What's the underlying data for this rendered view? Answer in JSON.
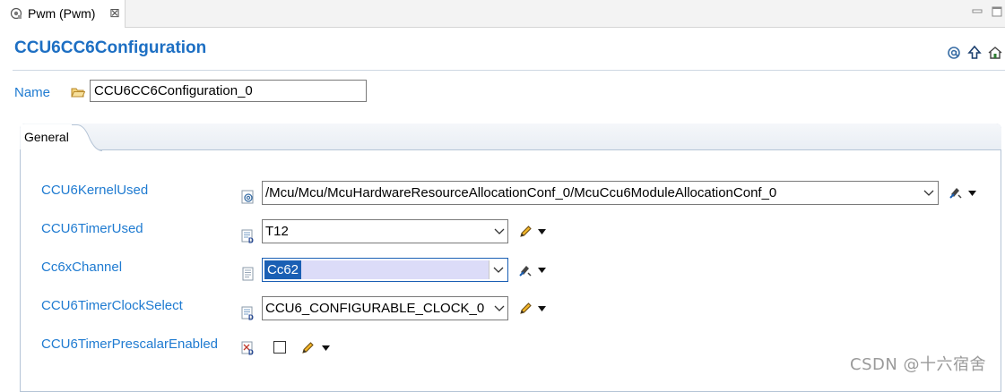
{
  "editor_tab": {
    "label": "Pwm (Pwm)",
    "close": "⊠"
  },
  "header": {
    "title": "CCU6CC6Configuration",
    "icons": [
      "at-sign-icon",
      "arrow-up-icon",
      "home-icon"
    ]
  },
  "name_field": {
    "label": "Name",
    "value": "CCU6CC6Configuration_0"
  },
  "section": {
    "tab_label": "General"
  },
  "params": [
    {
      "label": "CCU6KernelUsed",
      "value": "/Mcu/Mcu/McuHardwareResourceAllocationConf_0/McuCcu6ModuleAllocationConf_0",
      "icon": "reference-icon",
      "action": "link-icon"
    },
    {
      "label": "CCU6TimerUsed",
      "value": "T12",
      "icon": "derived-param-icon",
      "action": "pencil-icon"
    },
    {
      "label": "Cc6xChannel",
      "value": "Cc62",
      "icon": "param-doc-icon",
      "action": "link-icon",
      "selected": true
    },
    {
      "label": "CCU6TimerClockSelect",
      "value": "CCU6_CONFIGURABLE_CLOCK_0",
      "icon": "derived-param-icon",
      "action": "pencil-icon"
    },
    {
      "label": "CCU6TimerPrescalarEnabled",
      "value": "",
      "icon": "boolean-param-icon",
      "action": "pencil-icon",
      "checked": false
    }
  ],
  "watermark": "CSDN @十六宿舍",
  "colors": {
    "title": "#1d6fc3",
    "label": "#1f7bd1",
    "selection": "#1a5fb4"
  }
}
